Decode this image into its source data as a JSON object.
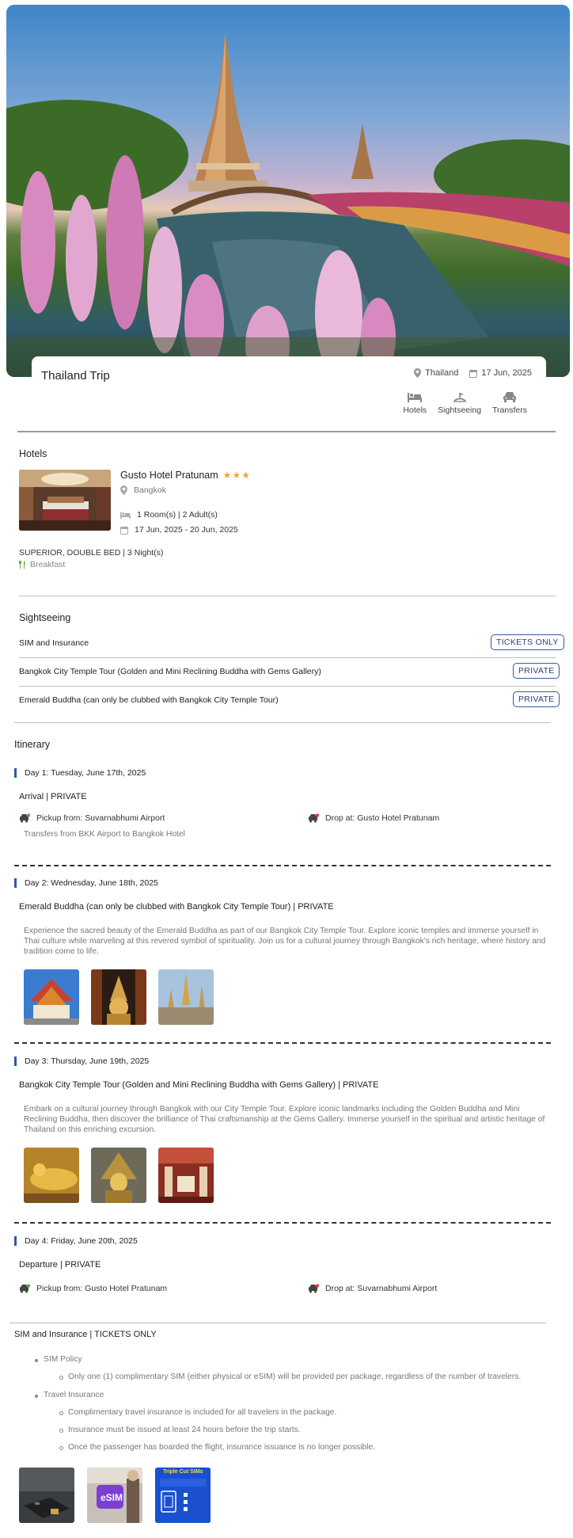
{
  "trip": {
    "title": "Thailand Trip",
    "country": "Thailand",
    "date": "17 Jun, 2025",
    "services": [
      {
        "label": "Hotels",
        "icon": "bed-icon"
      },
      {
        "label": "Sightseeing",
        "icon": "sightseeing-icon"
      },
      {
        "label": "Transfers",
        "icon": "car-icon"
      }
    ]
  },
  "hotels": {
    "heading": "Hotels",
    "name": "Gusto Hotel Pratunam",
    "stars": "★★★",
    "city": "Bangkok",
    "rooms": "1 Room(s) | 2 Adult(s)",
    "dates": "17 Jun, 2025 - 20 Jun, 2025",
    "room_type": "SUPERIOR, DOUBLE BED | 3 Night(s)",
    "meal": "Breakfast"
  },
  "sightseeing": {
    "heading": "Sightseeing",
    "items": [
      {
        "name": "SIM and Insurance",
        "tag": "TICKETS ONLY"
      },
      {
        "name": "Bangkok City Temple Tour (Golden and Mini Reclining Buddha with Gems Gallery)",
        "tag": "PRIVATE"
      },
      {
        "name": "Emerald Buddha (can only be clubbed with Bangkok City Temple Tour)",
        "tag": "PRIVATE"
      }
    ]
  },
  "itinerary": {
    "heading": "Itinerary",
    "days": [
      {
        "day": "Day 1: Tuesday, June 17th, 2025",
        "title": "Arrival | PRIVATE",
        "pickup": "Pickup from: Suvarnabhumi Airport",
        "drop": "Drop at: Gusto Hotel Pratunam",
        "note": "Transfers from BKK Airport to Bangkok Hotel"
      },
      {
        "day": "Day 2: Wednesday, June 18th, 2025",
        "title": "Emerald Buddha (can only be clubbed with Bangkok City Temple Tour) | PRIVATE",
        "desc": "Experience the sacred beauty of the Emerald Buddha as part of our Bangkok City Temple Tour. Explore iconic temples and immerse yourself in Thai culture while marveling at this revered symbol of spirituality. Join us for a cultural journey through Bangkok's rich heritage, where history and tradition come to life."
      },
      {
        "day": "Day 3: Thursday, June 19th, 2025",
        "title": "Bangkok City Temple Tour (Golden and Mini Reclining Buddha with Gems Gallery) | PRIVATE",
        "desc": "Embark on a cultural journey through Bangkok with our City Temple Tour. Explore iconic landmarks including the Golden Buddha and Mini Reclining Buddha, then discover the brilliance of Thai craftsmanship at the Gems Gallery. Immerse yourself in the spiritual and artistic heritage of Thailand on this enriching excursion."
      },
      {
        "day": "Day 4: Friday, June 20th, 2025",
        "title": "Departure | PRIVATE",
        "pickup": "Pickup from: Gusto Hotel Pratunam",
        "drop": "Drop at: Suvarnabhumi Airport"
      }
    ]
  },
  "sim": {
    "heading": "SIM and Insurance | TICKETS ONLY",
    "sim_policy": "SIM Policy",
    "sim_points": [
      "Only one (1) complimentary SIM (either physical or eSIM) will be provided per package, regardless of the number of travelers."
    ],
    "travel_insurance": "Travel Insurance",
    "insurance_points": [
      "Complimentary travel insurance is included for all travelers in the package.",
      "Insurance must be issued at least 24 hours before the trip starts.",
      "Once the passenger has boarded the flight, insurance issuance is no longer possible."
    ],
    "esim_label": "eSIM",
    "triple_title": "Triple Cut SIMs"
  },
  "colors": {
    "accent": "#3557a3",
    "star": "#f0a832",
    "meal_green": "#6aa84f"
  }
}
